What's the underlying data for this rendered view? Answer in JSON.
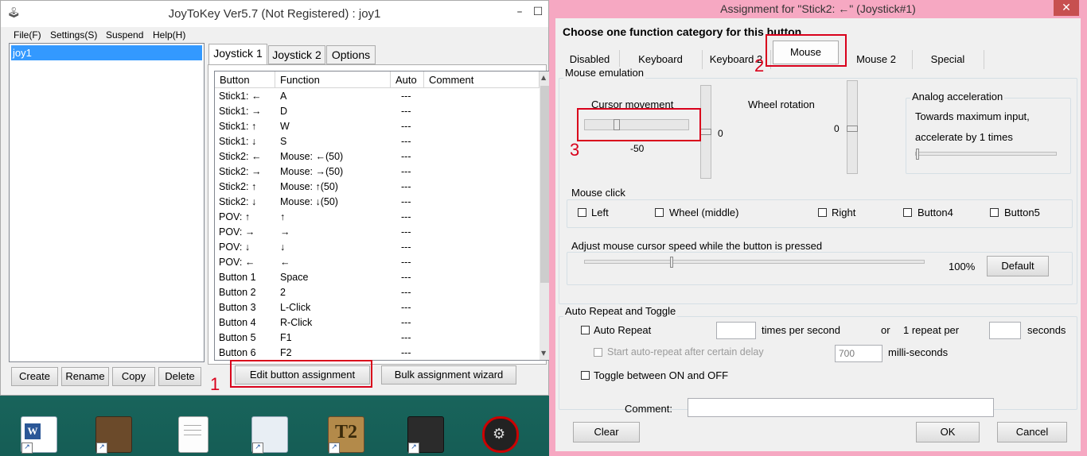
{
  "joy": {
    "title": "JoyToKey Ver5.7 (Not Registered) : joy1",
    "controls": {
      "minimize": "–",
      "maximize": "☐"
    },
    "menu": [
      "File(F)",
      "Settings(S)",
      "Suspend",
      "Help(H)"
    ],
    "profiles": [
      "joy1"
    ],
    "profile_buttons": [
      "Create",
      "Rename",
      "Copy",
      "Delete"
    ],
    "tabs": [
      "Joystick 1",
      "Joystick 2",
      "Options"
    ],
    "columns": [
      "Button",
      "Function",
      "Auto",
      "Comment"
    ],
    "rows": [
      {
        "button": "Stick1: ←",
        "function": "A",
        "auto": "---"
      },
      {
        "button": "Stick1: →",
        "function": "D",
        "auto": "---"
      },
      {
        "button": "Stick1: ↑",
        "function": "W",
        "auto": "---"
      },
      {
        "button": "Stick1: ↓",
        "function": "S",
        "auto": "---"
      },
      {
        "button": "Stick2: ←",
        "function": "Mouse: ←(50)",
        "auto": "---"
      },
      {
        "button": "Stick2: →",
        "function": "Mouse: →(50)",
        "auto": "---"
      },
      {
        "button": "Stick2: ↑",
        "function": "Mouse: ↑(50)",
        "auto": "---"
      },
      {
        "button": "Stick2: ↓",
        "function": "Mouse: ↓(50)",
        "auto": "---"
      },
      {
        "button": "POV: ↑",
        "function": "↑",
        "auto": "---"
      },
      {
        "button": "POV: →",
        "function": "→",
        "auto": "---"
      },
      {
        "button": "POV: ↓",
        "function": "↓",
        "auto": "---"
      },
      {
        "button": "POV: ←",
        "function": "←",
        "auto": "---"
      },
      {
        "button": "Button 1",
        "function": "Space",
        "auto": "---"
      },
      {
        "button": "Button 2",
        "function": "2",
        "auto": "---"
      },
      {
        "button": "Button 3",
        "function": "L-Click",
        "auto": "---"
      },
      {
        "button": "Button 4",
        "function": "R-Click",
        "auto": "---"
      },
      {
        "button": "Button 5",
        "function": "F1",
        "auto": "---"
      },
      {
        "button": "Button 6",
        "function": "F2",
        "auto": "---"
      }
    ],
    "edit_button": "Edit button assignment",
    "bulk_button": "Bulk assignment wizard"
  },
  "annotations": {
    "a1": "1",
    "a2": "2",
    "a3": "3"
  },
  "assign": {
    "title": "Assignment for \"Stick2: ←\" (Joystick#1)",
    "close": "✕",
    "heading": "Choose one function category for this button",
    "categories": [
      "Disabled",
      "Keyboard",
      "Keyboard 2",
      "Mouse",
      "Mouse 2",
      "Special"
    ],
    "selected_category": "Mouse",
    "mouse_emulation": {
      "label": "Mouse emulation",
      "cursor_label": "Cursor movement",
      "cursor_value": "-50",
      "vertical_value": "0",
      "wheel_label": "Wheel rotation",
      "wheel_value": "0",
      "analog_label": "Analog acceleration",
      "analog_line1": "Towards maximum input,",
      "analog_line2": "accelerate by 1 times"
    },
    "mouse_click": {
      "label": "Mouse click",
      "options": [
        "Left",
        "Wheel (middle)",
        "Right",
        "Button4",
        "Button5"
      ]
    },
    "speed": {
      "label": "Adjust mouse cursor speed while the button is pressed",
      "value": "100%",
      "default_button": "Default"
    },
    "auto_repeat": {
      "label": "Auto Repeat and Toggle",
      "auto_repeat": "Auto Repeat",
      "times_per_second": "times per second",
      "or": "or",
      "one_repeat_per": "1 repeat per",
      "seconds": "seconds",
      "start_delay": "Start auto-repeat after certain delay",
      "delay_value": "700",
      "milli_seconds": "milli-seconds",
      "toggle": "Toggle between ON and OFF"
    },
    "comment_label": "Comment:",
    "buttons": {
      "clear": "Clear",
      "ok": "OK",
      "cancel": "Cancel"
    }
  }
}
